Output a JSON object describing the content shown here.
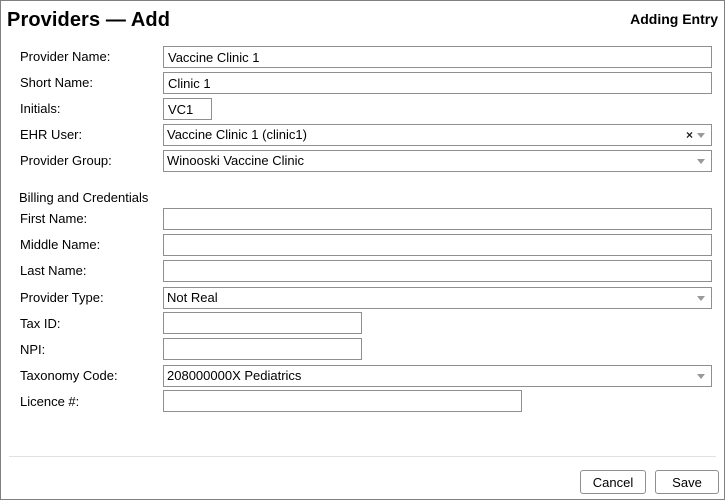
{
  "header": {
    "title": "Providers — Add",
    "mode": "Adding Entry"
  },
  "form": {
    "provider_name": {
      "label": "Provider Name:",
      "value": "Vaccine Clinic 1"
    },
    "short_name": {
      "label": "Short Name:",
      "value": "Clinic 1"
    },
    "initials": {
      "label": "Initials:",
      "value": "VC1"
    },
    "ehr_user": {
      "label": "EHR User:",
      "value": "Vaccine Clinic 1 (clinic1)",
      "clear_glyph": "×"
    },
    "provider_group": {
      "label": "Provider Group:",
      "value": "Winooski Vaccine Clinic"
    },
    "billing_section": "Billing and Credentials",
    "first_name": {
      "label": "First Name:",
      "value": ""
    },
    "middle_name": {
      "label": "Middle Name:",
      "value": ""
    },
    "last_name": {
      "label": "Last Name:",
      "value": ""
    },
    "provider_type": {
      "label": "Provider Type:",
      "value": "Not Real"
    },
    "tax_id": {
      "label": "Tax ID:",
      "value": ""
    },
    "npi": {
      "label": "NPI:",
      "value": ""
    },
    "taxonomy_code": {
      "label": "Taxonomy Code:",
      "value": "208000000X Pediatrics"
    },
    "licence": {
      "label": "Licence #:",
      "value": ""
    }
  },
  "footer": {
    "cancel_label": "Cancel",
    "save_label": "Save"
  },
  "icons": {
    "dropdown": "chevron-down-icon",
    "clear": "clear-icon"
  }
}
